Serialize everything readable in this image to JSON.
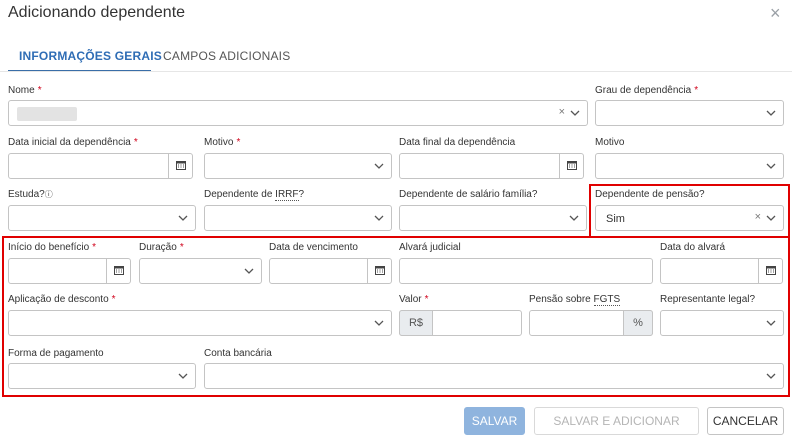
{
  "dialog": {
    "title": "Adicionando dependente",
    "close_symbol": "×"
  },
  "tabs": [
    {
      "label": "INFORMAÇÕES GERAIS",
      "active": true
    },
    {
      "label": "CAMPOS ADICIONAIS",
      "active": false
    }
  ],
  "fields": {
    "nome": {
      "label": "Nome",
      "required": true,
      "value": "",
      "clear_symbol": "×"
    },
    "grau": {
      "label": "Grau de dependência",
      "required": true
    },
    "data_inicial": {
      "label": "Data inicial da dependência",
      "required": true
    },
    "motivo1": {
      "label": "Motivo",
      "required": true
    },
    "data_final": {
      "label": "Data final da dependência"
    },
    "motivo2": {
      "label": "Motivo"
    },
    "estuda": {
      "label": "Estuda?",
      "info_symbol": "ⓘ"
    },
    "dep_irrf": {
      "label_prefix": "Dependente de ",
      "label_abbr": "IRRF",
      "label_suffix": "?"
    },
    "dep_salario": {
      "label": "Dependente de salário família?"
    },
    "dep_pensao": {
      "label": "Dependente de pensão?",
      "value": "Sim",
      "clear_symbol": "×"
    },
    "inicio_beneficio": {
      "label": "Início do benefício",
      "required": true
    },
    "duracao": {
      "label": "Duração",
      "required": true
    },
    "data_vencimento": {
      "label": "Data de vencimento"
    },
    "alvara": {
      "label": "Alvará judicial"
    },
    "data_alvara": {
      "label": "Data do alvará"
    },
    "aplicacao_desconto": {
      "label": "Aplicação de desconto",
      "required": true
    },
    "valor": {
      "label": "Valor",
      "required": true,
      "prefix": "R$"
    },
    "pensao_fgts": {
      "label_prefix": "Pensão sobre ",
      "label_abbr": "FGTS",
      "suffix": "%"
    },
    "representante": {
      "label": "Representante legal?"
    },
    "forma_pagamento": {
      "label": "Forma de pagamento"
    },
    "conta_bancaria": {
      "label": "Conta bancária"
    }
  },
  "required_marker": "*",
  "buttons": {
    "save": "SALVAR",
    "save_add": "SALVAR E ADICIONAR NOVO",
    "cancel": "CANCELAR"
  },
  "colors": {
    "accent": "#2f6db5",
    "highlight_border": "#e00000",
    "required": "#d0021b",
    "save_button": "#8fb4de"
  }
}
